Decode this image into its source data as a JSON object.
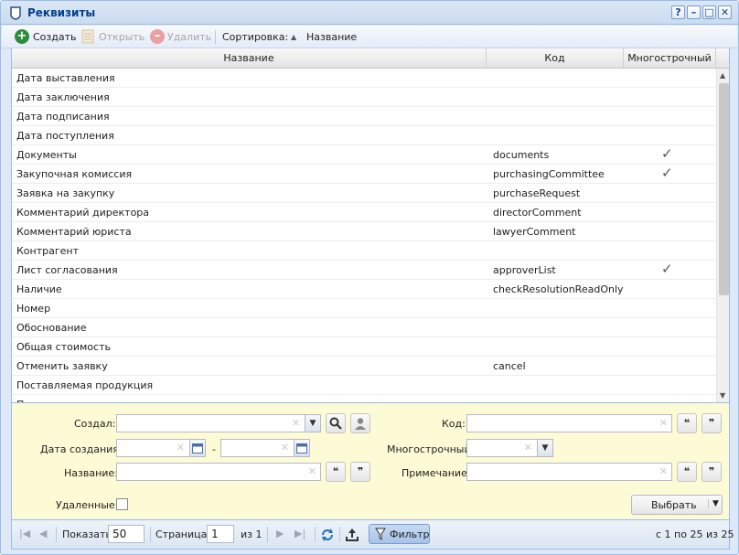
{
  "window": {
    "title": "Реквизиты",
    "controls": [
      "?",
      "–",
      "□",
      "✕"
    ]
  },
  "toolbar": {
    "create": "Создать",
    "open": "Открыть",
    "delete": "Удалить",
    "sort_label": "Сортировка:",
    "sort_value": "Название"
  },
  "grid": {
    "columns": [
      "Название",
      "Код",
      "Многострочный"
    ],
    "rows": [
      {
        "name": "Дата выставления",
        "code": "",
        "multi": ""
      },
      {
        "name": "Дата заключения",
        "code": "",
        "multi": ""
      },
      {
        "name": "Дата подписания",
        "code": "",
        "multi": ""
      },
      {
        "name": "Дата поступления",
        "code": "",
        "multi": ""
      },
      {
        "name": "Документы",
        "code": "documents",
        "multi": "✓"
      },
      {
        "name": "Закупочная комиссия",
        "code": "purchasingCommittee",
        "multi": "✓"
      },
      {
        "name": "Заявка на закупку",
        "code": "purchaseRequest",
        "multi": ""
      },
      {
        "name": "Комментарий директора",
        "code": "directorComment",
        "multi": ""
      },
      {
        "name": "Комментарий юриста",
        "code": "lawyerComment",
        "multi": ""
      },
      {
        "name": "Контрагент",
        "code": "",
        "multi": ""
      },
      {
        "name": "Лист согласования",
        "code": "approverList",
        "multi": "✓"
      },
      {
        "name": "Наличие",
        "code": "checkResolutionReadOnly",
        "multi": ""
      },
      {
        "name": "Номер",
        "code": "",
        "multi": ""
      },
      {
        "name": "Обоснование",
        "code": "",
        "multi": ""
      },
      {
        "name": "Общая стоимость",
        "code": "",
        "multi": ""
      },
      {
        "name": "Отменить заявку",
        "code": "cancel",
        "multi": ""
      },
      {
        "name": "Поставляемая продукция",
        "code": "",
        "multi": ""
      },
      {
        "name": "П",
        "code": "",
        "multi": ""
      }
    ]
  },
  "filter": {
    "created_by_label": "Создал:",
    "created_date_label": "Дата создания:",
    "date_dash": "-",
    "name_label": "Название:",
    "code_label": "Код:",
    "multiline_label": "Многострочный:",
    "note_label": "Примечание:",
    "deleted_label": "Удаленные:",
    "select_button": "Выбрать",
    "quote_open": "❝",
    "quote_close": "❞"
  },
  "footer": {
    "show_label": "Показать",
    "page_size": "50",
    "page_label": "Страница",
    "page_value": "1",
    "of_pages": "из 1",
    "filter_button": "Фильтр",
    "range_info": "с 1 по 25 из 25"
  }
}
